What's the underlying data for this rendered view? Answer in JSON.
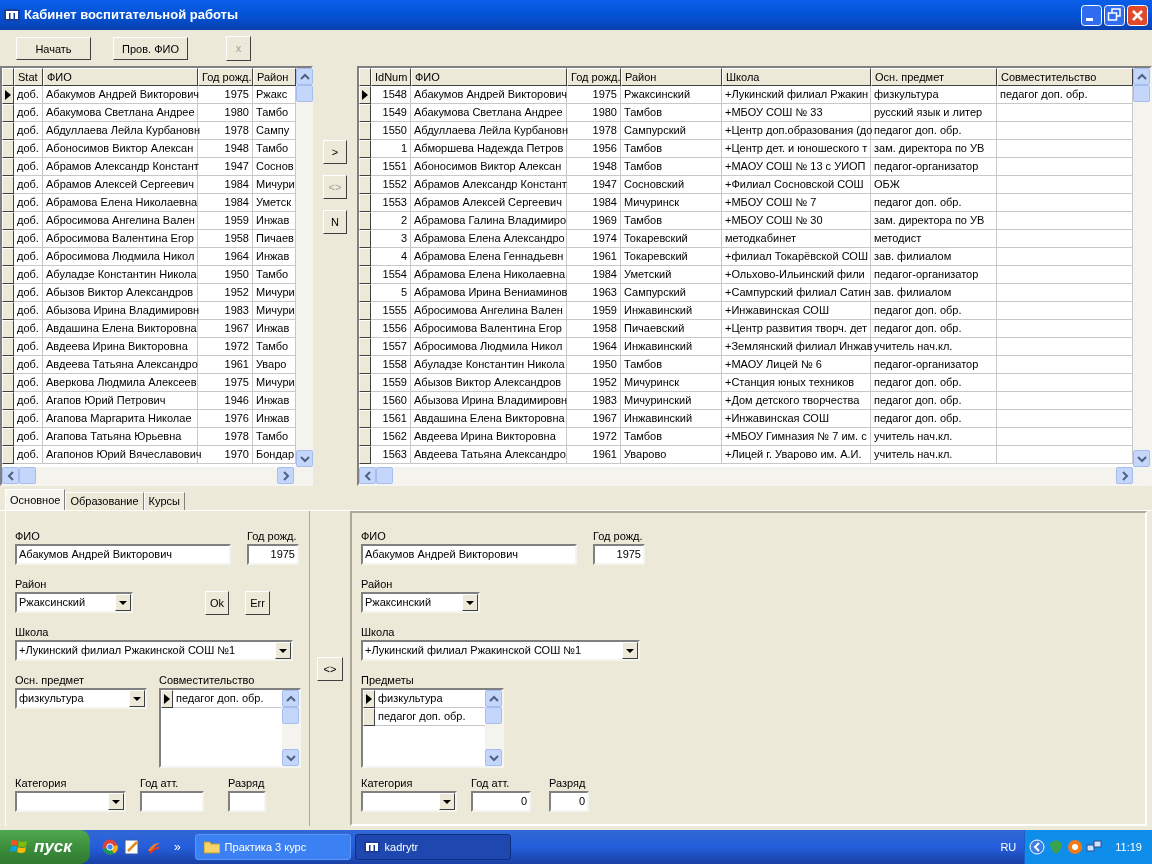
{
  "window": {
    "title": "Кабинет воспитательной работы"
  },
  "toolbar": [
    {
      "label": "Начать",
      "disabled": false
    },
    {
      "label": "Пров. ФИО",
      "disabled": false
    },
    {
      "label": "x",
      "disabled": true
    }
  ],
  "left_grid": {
    "columns": [
      "Stat",
      "ФИО",
      "Год рожд.",
      "Район"
    ],
    "rows": [
      {
        "selected": true,
        "stat": "доб.",
        "fio": "Абакумов Андрей Викторович",
        "year": "1975",
        "district": "Ржакс"
      },
      {
        "selected": false,
        "stat": "доб.",
        "fio": "Абакумова Светлана Андрее",
        "year": "1980",
        "district": "Тамбо"
      },
      {
        "selected": false,
        "stat": "доб.",
        "fio": "Абдуллаева Лейла Курбановн",
        "year": "1978",
        "district": "Сампу"
      },
      {
        "selected": false,
        "stat": "доб.",
        "fio": "Абоносимов Виктор Алексан",
        "year": "1948",
        "district": "Тамбо"
      },
      {
        "selected": false,
        "stat": "доб.",
        "fio": "Абрамов Александр Констант",
        "year": "1947",
        "district": "Соснов"
      },
      {
        "selected": false,
        "stat": "доб.",
        "fio": "Абрамов Алексей Сергеевич",
        "year": "1984",
        "district": "Мичури"
      },
      {
        "selected": false,
        "stat": "доб.",
        "fio": "Абрамова Елена Николаевна",
        "year": "1984",
        "district": "Уметск"
      },
      {
        "selected": false,
        "stat": "доб.",
        "fio": "Абросимова Ангелина Вален",
        "year": "1959",
        "district": "Инжав"
      },
      {
        "selected": false,
        "stat": "доб.",
        "fio": "Абросимова Валентина Егор",
        "year": "1958",
        "district": "Пичаев"
      },
      {
        "selected": false,
        "stat": "доб.",
        "fio": "Абросимова Людмила Никол",
        "year": "1964",
        "district": "Инжав"
      },
      {
        "selected": false,
        "stat": "доб.",
        "fio": "Абуладзе Константин Никола",
        "year": "1950",
        "district": "Тамбо"
      },
      {
        "selected": false,
        "stat": "доб.",
        "fio": "Абызов Виктор Александров",
        "year": "1952",
        "district": "Мичури"
      },
      {
        "selected": false,
        "stat": "доб.",
        "fio": "Абызова Ирина Владимировн",
        "year": "1983",
        "district": "Мичури"
      },
      {
        "selected": false,
        "stat": "доб.",
        "fio": "Авдашина Елена Викторовна",
        "year": "1967",
        "district": "Инжав"
      },
      {
        "selected": false,
        "stat": "доб.",
        "fio": "Авдеева Ирина Викторовна",
        "year": "1972",
        "district": "Тамбо"
      },
      {
        "selected": false,
        "stat": "доб.",
        "fio": "Авдеева Татьяна Александро",
        "year": "1961",
        "district": "Уваро"
      },
      {
        "selected": false,
        "stat": "доб.",
        "fio": "Аверкова Людмила Алексеев",
        "year": "1975",
        "district": "Мичури"
      },
      {
        "selected": false,
        "stat": "доб.",
        "fio": "Агапов Юрий Петрович",
        "year": "1946",
        "district": "Инжав"
      },
      {
        "selected": false,
        "stat": "доб.",
        "fio": "Агапова Маргарита Николае",
        "year": "1976",
        "district": "Инжав"
      },
      {
        "selected": false,
        "stat": "доб.",
        "fio": "Агапова Татьяна Юрьевна",
        "year": "1978",
        "district": "Тамбо"
      },
      {
        "selected": false,
        "stat": "доб.",
        "fio": "Агапонов Юрий Вячеславович",
        "year": "1970",
        "district": "Бондар"
      }
    ]
  },
  "transfer_buttons": [
    {
      "label": ">",
      "disabled": false
    },
    {
      "label": "<>",
      "disabled": true
    },
    {
      "label": "N",
      "disabled": false
    }
  ],
  "right_grid": {
    "columns": [
      "IdNum",
      "ФИО",
      "Год рожд.",
      "Район",
      "Школа",
      "Осн. предмет",
      "Совместительство"
    ],
    "rows": [
      {
        "selected": true,
        "id": "1548",
        "fio": "Абакумов Андрей Викторович",
        "year": "1975",
        "district": "Ржаксинский",
        "school": "+Лукинский филиал Ржакин",
        "subject": "физкультура",
        "secondary": "педагог доп. обр."
      },
      {
        "selected": false,
        "id": "1549",
        "fio": "Абакумова Светлана Андрее",
        "year": "1980",
        "district": "Тамбов",
        "school": "+МБОУ СОШ № 33",
        "subject": "русский язык и литер"
      },
      {
        "selected": false,
        "id": "1550",
        "fio": "Абдуллаева Лейла Курбановн",
        "year": "1978",
        "district": "Сампурский",
        "school": "+Центр доп.образования (до",
        "subject": "педагог доп. обр."
      },
      {
        "selected": false,
        "id": "1",
        "fio": "Абморшева Надежда Петров",
        "year": "1956",
        "district": "Тамбов",
        "school": "+Центр дет. и юношеского т",
        "subject": "зам. директора по УВ"
      },
      {
        "selected": false,
        "id": "1551",
        "fio": "Абоносимов Виктор Алексан",
        "year": "1948",
        "district": "Тамбов",
        "school": "+МАОУ СОШ № 13 с УИОП",
        "subject": "педагог-организатор"
      },
      {
        "selected": false,
        "id": "1552",
        "fio": "Абрамов Александр Констант",
        "year": "1947",
        "district": "Сосновский",
        "school": "+Филиал Сосновской СОШ",
        "subject": "ОБЖ"
      },
      {
        "selected": false,
        "id": "1553",
        "fio": "Абрамов Алексей Сергеевич",
        "year": "1984",
        "district": "Мичуринск",
        "school": "+МБОУ СОШ № 7",
        "subject": "педагог доп. обр."
      },
      {
        "selected": false,
        "id": "2",
        "fio": "Абрамова Галина Владимиро",
        "year": "1969",
        "district": "Тамбов",
        "school": "+МБОУ СОШ № 30",
        "subject": "зам. директора по УВ"
      },
      {
        "selected": false,
        "id": "3",
        "fio": "Абрамова Елена Александро",
        "year": "1974",
        "district": "Токаревский",
        "school": "методкабинет",
        "subject": "методист"
      },
      {
        "selected": false,
        "id": "4",
        "fio": "Абрамова Елена Геннадьевн",
        "year": "1961",
        "district": "Токаревский",
        "school": "+филиал Токарёвской СОШ",
        "subject": "зав. филиалом"
      },
      {
        "selected": false,
        "id": "1554",
        "fio": "Абрамова Елена Николаевна",
        "year": "1984",
        "district": "Уметский",
        "school": "+Ольхово-Ильинский фили",
        "subject": "педагог-организатор"
      },
      {
        "selected": false,
        "id": "5",
        "fio": "Абрамова Ирина Вениаминов",
        "year": "1963",
        "district": "Сампурский",
        "school": "+Сампурский филиал Сатин",
        "subject": "зав. филиалом"
      },
      {
        "selected": false,
        "id": "1555",
        "fio": "Абросимова Ангелина Вален",
        "year": "1959",
        "district": "Инжавинский",
        "school": "+Инжавинская СОШ",
        "subject": "педагог доп. обр."
      },
      {
        "selected": false,
        "id": "1556",
        "fio": "Абросимова Валентина Егор",
        "year": "1958",
        "district": "Пичаевский",
        "school": "+Центр развития творч. дет",
        "subject": "педагог доп. обр."
      },
      {
        "selected": false,
        "id": "1557",
        "fio": "Абросимова Людмила Никол",
        "year": "1964",
        "district": "Инжавинский",
        "school": "+Землянский филиал Инжав",
        "subject": "учитель нач.кл."
      },
      {
        "selected": false,
        "id": "1558",
        "fio": "Абуладзе Константин Никола",
        "year": "1950",
        "district": "Тамбов",
        "school": "+МАОУ Лицей № 6",
        "subject": "педагог-организатор"
      },
      {
        "selected": false,
        "id": "1559",
        "fio": "Абызов Виктор Александров",
        "year": "1952",
        "district": "Мичуринск",
        "school": "+Станция юных техников",
        "subject": "педагог доп. обр."
      },
      {
        "selected": false,
        "id": "1560",
        "fio": "Абызова Ирина Владимировн",
        "year": "1983",
        "district": "Мичуринский",
        "school": "+Дом детского творчества",
        "subject": "педагог доп. обр."
      },
      {
        "selected": false,
        "id": "1561",
        "fio": "Авдашина Елена Викторовна",
        "year": "1967",
        "district": "Инжавинский",
        "school": "+Инжавинская СОШ",
        "subject": "педагог доп. обр."
      },
      {
        "selected": false,
        "id": "1562",
        "fio": "Авдеева Ирина Викторовна",
        "year": "1972",
        "district": "Тамбов",
        "school": "+МБОУ Гимназия № 7 им. с",
        "subject": "учитель нач.кл."
      },
      {
        "selected": false,
        "id": "1563",
        "fio": "Авдеева Татьяна Александро",
        "year": "1961",
        "district": "Уварово",
        "school": "+Лицей г. Уварово им. А.И.",
        "subject": "учитель нач.кл."
      }
    ]
  },
  "tabs": [
    {
      "label": "Основное",
      "selected": true
    },
    {
      "label": "Образование",
      "selected": false
    },
    {
      "label": "Курсы",
      "selected": false
    }
  ],
  "left_form": {
    "fio_label": "ФИО",
    "fio": "Абакумов Андрей Викторович",
    "year_label": "Год рожд.",
    "year": "1975",
    "district_label": "Район",
    "district": "Ржаксинский",
    "ok_button": "Ok",
    "err_button": "Err",
    "school_label": "Школа",
    "school": "+Лукинский филиал Ржакинской СОШ №1",
    "subject_label": "Осн. предмет",
    "subject": "физкультура",
    "secondary_label": "Совместительство",
    "secondary_rows": [
      {
        "text": "педагог доп. обр.",
        "selected": true
      }
    ],
    "category_label": "Категория",
    "att_label": "Год атт.",
    "rank_label": "Разряд"
  },
  "copy_button": "<>",
  "right_form": {
    "fio_label": "ФИО",
    "fio": "Абакумов Андрей Викторович",
    "year_label": "Год рожд.",
    "year": "1975",
    "district_label": "Район",
    "district": "Ржаксинский",
    "school_label": "Школа",
    "school": "+Лукинский филиал Ржакинской СОШ №1",
    "subjects_label": "Предметы",
    "subjects": [
      {
        "text": "физкультура",
        "selected": true
      },
      {
        "text": "педагог доп. обр.",
        "selected": false
      }
    ],
    "category_label": "Категория",
    "att_label": "Год атт.",
    "att": "0",
    "rank_label": "Разряд",
    "rank": "0"
  },
  "taskbar": {
    "start": "пуск",
    "more": "»",
    "tasks": [
      {
        "label": "Практика 3 курс",
        "kind": "folder",
        "selected": false
      },
      {
        "label": "kadrytr",
        "kind": "app",
        "selected": true
      }
    ],
    "language": "RU",
    "time": "11:19"
  }
}
